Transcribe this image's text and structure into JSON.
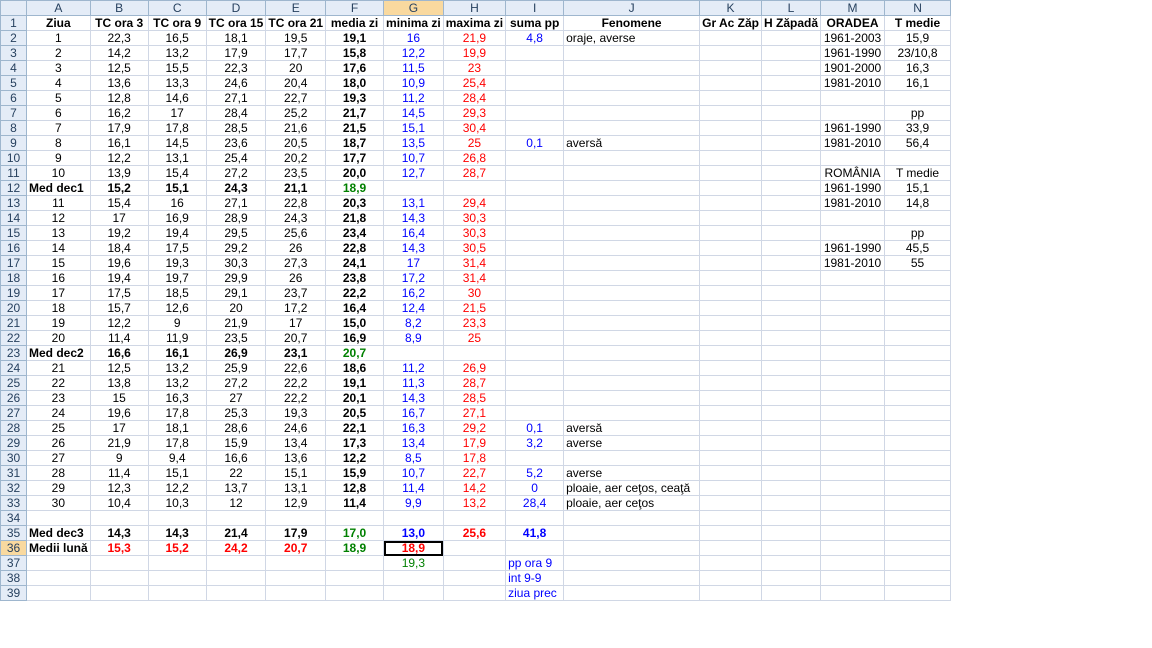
{
  "columns": [
    "A",
    "B",
    "C",
    "D",
    "E",
    "F",
    "G",
    "H",
    "I",
    "J",
    "K",
    "L",
    "M",
    "N"
  ],
  "selected_column": "G",
  "selected_row": 36,
  "header_row": [
    "Ziua",
    "TC ora 3",
    "TC ora 9",
    "TC ora 15",
    "TC ora 21",
    "media zi",
    "minima zi",
    "maxima zi",
    "suma pp",
    "Fenomene",
    "Gr Ac Zăp",
    "H Zăpadă",
    "ORADEA",
    "T medie"
  ],
  "rows": [
    [
      "1",
      "22,3",
      "16,5",
      "18,1",
      "19,5",
      "19,1",
      "16",
      "21,9",
      "4,8",
      "oraje, averse",
      "",
      "",
      "1961-2003",
      "15,9"
    ],
    [
      "2",
      "14,2",
      "13,2",
      "17,9",
      "17,7",
      "15,8",
      "12,2",
      "19,9",
      "",
      "",
      "",
      "",
      "1961-1990",
      "23/10,8"
    ],
    [
      "3",
      "12,5",
      "15,5",
      "22,3",
      "20",
      "17,6",
      "11,5",
      "23",
      "",
      "",
      "",
      "",
      "1901-2000",
      "16,3"
    ],
    [
      "4",
      "13,6",
      "13,3",
      "24,6",
      "20,4",
      "18,0",
      "10,9",
      "25,4",
      "",
      "",
      "",
      "",
      "1981-2010",
      "16,1"
    ],
    [
      "5",
      "12,8",
      "14,6",
      "27,1",
      "22,7",
      "19,3",
      "11,2",
      "28,4",
      "",
      "",
      "",
      "",
      "",
      ""
    ],
    [
      "6",
      "16,2",
      "17",
      "28,4",
      "25,2",
      "21,7",
      "14,5",
      "29,3",
      "",
      "",
      "",
      "",
      "",
      "pp"
    ],
    [
      "7",
      "17,9",
      "17,8",
      "28,5",
      "21,6",
      "21,5",
      "15,1",
      "30,4",
      "",
      "",
      "",
      "",
      "1961-1990",
      "33,9"
    ],
    [
      "8",
      "16,1",
      "14,5",
      "23,6",
      "20,5",
      "18,7",
      "13,5",
      "25",
      "0,1",
      "aversă",
      "",
      "",
      "1981-2010",
      "56,4"
    ],
    [
      "9",
      "12,2",
      "13,1",
      "25,4",
      "20,2",
      "17,7",
      "10,7",
      "26,8",
      "",
      "",
      "",
      "",
      "",
      ""
    ],
    [
      "10",
      "13,9",
      "15,4",
      "27,2",
      "23,5",
      "20,0",
      "12,7",
      "28,7",
      "",
      "",
      "",
      "",
      "ROMÂNIA",
      "T medie"
    ],
    [
      "Med dec1",
      "15,2",
      "15,1",
      "24,3",
      "21,1",
      "18,9",
      "",
      "",
      "",
      "",
      "",
      "",
      "1961-1990",
      "15,1"
    ],
    [
      "11",
      "15,4",
      "16",
      "27,1",
      "22,8",
      "20,3",
      "13,1",
      "29,4",
      "",
      "",
      "",
      "",
      "1981-2010",
      "14,8"
    ],
    [
      "12",
      "17",
      "16,9",
      "28,9",
      "24,3",
      "21,8",
      "14,3",
      "30,3",
      "",
      "",
      "",
      "",
      "",
      ""
    ],
    [
      "13",
      "19,2",
      "19,4",
      "29,5",
      "25,6",
      "23,4",
      "16,4",
      "30,3",
      "",
      "",
      "",
      "",
      "",
      "pp"
    ],
    [
      "14",
      "18,4",
      "17,5",
      "29,2",
      "26",
      "22,8",
      "14,3",
      "30,5",
      "",
      "",
      "",
      "",
      "1961-1990",
      "45,5"
    ],
    [
      "15",
      "19,6",
      "19,3",
      "30,3",
      "27,3",
      "24,1",
      "17",
      "31,4",
      "",
      "",
      "",
      "",
      "1981-2010",
      "55"
    ],
    [
      "16",
      "19,4",
      "19,7",
      "29,9",
      "26",
      "23,8",
      "17,2",
      "31,4",
      "",
      "",
      "",
      "",
      "",
      ""
    ],
    [
      "17",
      "17,5",
      "18,5",
      "29,1",
      "23,7",
      "22,2",
      "16,2",
      "30",
      "",
      "",
      "",
      "",
      "",
      ""
    ],
    [
      "18",
      "15,7",
      "12,6",
      "20",
      "17,2",
      "16,4",
      "12,4",
      "21,5",
      "",
      "",
      "",
      "",
      "",
      ""
    ],
    [
      "19",
      "12,2",
      "9",
      "21,9",
      "17",
      "15,0",
      "8,2",
      "23,3",
      "",
      "",
      "",
      "",
      "",
      ""
    ],
    [
      "20",
      "11,4",
      "11,9",
      "23,5",
      "20,7",
      "16,9",
      "8,9",
      "25",
      "",
      "",
      "",
      "",
      "",
      ""
    ],
    [
      "Med dec2",
      "16,6",
      "16,1",
      "26,9",
      "23,1",
      "20,7",
      "",
      "",
      "",
      "",
      "",
      "",
      "",
      ""
    ],
    [
      "21",
      "12,5",
      "13,2",
      "25,9",
      "22,6",
      "18,6",
      "11,2",
      "26,9",
      "",
      "",
      "",
      "",
      "",
      ""
    ],
    [
      "22",
      "13,8",
      "13,2",
      "27,2",
      "22,2",
      "19,1",
      "11,3",
      "28,7",
      "",
      "",
      "",
      "",
      "",
      ""
    ],
    [
      "23",
      "15",
      "16,3",
      "27",
      "22,2",
      "20,1",
      "14,3",
      "28,5",
      "",
      "",
      "",
      "",
      "",
      ""
    ],
    [
      "24",
      "19,6",
      "17,8",
      "25,3",
      "19,3",
      "20,5",
      "16,7",
      "27,1",
      "",
      "",
      "",
      "",
      "",
      ""
    ],
    [
      "25",
      "17",
      "18,1",
      "28,6",
      "24,6",
      "22,1",
      "16,3",
      "29,2",
      "0,1",
      "aversă",
      "",
      "",
      "",
      ""
    ],
    [
      "26",
      "21,9",
      "17,8",
      "15,9",
      "13,4",
      "17,3",
      "13,4",
      "17,9",
      "3,2",
      "averse",
      "",
      "",
      "",
      ""
    ],
    [
      "27",
      "9",
      "9,4",
      "16,6",
      "13,6",
      "12,2",
      "8,5",
      "17,8",
      "",
      "",
      "",
      "",
      "",
      ""
    ],
    [
      "28",
      "11,4",
      "15,1",
      "22",
      "15,1",
      "15,9",
      "10,7",
      "22,7",
      "5,2",
      "averse",
      "",
      "",
      "",
      ""
    ],
    [
      "29",
      "12,3",
      "12,2",
      "13,7",
      "13,1",
      "12,8",
      "11,4",
      "14,2",
      "0",
      "ploaie, aer ceţos, ceaţă",
      "",
      "",
      "",
      ""
    ],
    [
      "30",
      "10,4",
      "10,3",
      "12",
      "12,9",
      "11,4",
      "9,9",
      "13,2",
      "28,4",
      "ploaie, aer ceţos",
      "",
      "",
      "",
      ""
    ],
    [
      "",
      "",
      "",
      "",
      "",
      "",
      "",
      "",
      "",
      "",
      "",
      "",
      "",
      ""
    ],
    [
      "Med dec3",
      "14,3",
      "14,3",
      "21,4",
      "17,9",
      "17,0",
      "13,0",
      "25,6",
      "41,8",
      "",
      "",
      "",
      "",
      ""
    ],
    [
      "Medii lună",
      "15,3",
      "15,2",
      "24,2",
      "20,7",
      "18,9",
      "18,9",
      "",
      "",
      "",
      "",
      "",
      "",
      ""
    ],
    [
      "",
      "",
      "",
      "",
      "",
      "",
      "19,3",
      "",
      "pp ora 9",
      "",
      "",
      "",
      "",
      ""
    ],
    [
      "",
      "",
      "",
      "",
      "",
      "",
      "",
      "",
      "int 9-9",
      "",
      "",
      "",
      "",
      ""
    ],
    [
      "",
      "",
      "",
      "",
      "",
      "",
      "",
      "",
      "ziua prec",
      "",
      "",
      "",
      "",
      ""
    ]
  ]
}
